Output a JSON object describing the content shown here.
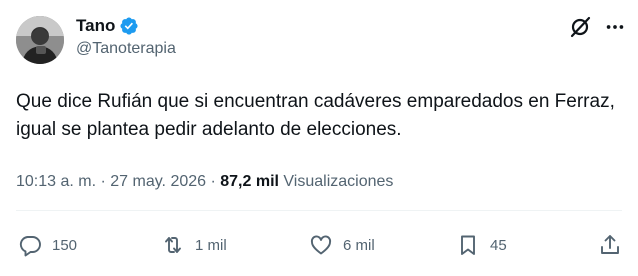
{
  "user": {
    "name": "Tano",
    "handle": "@Tanoterapia"
  },
  "tweet": {
    "text": "Que dice Rufián que si encuentran cadáveres emparedados en Ferraz, igual se plantea pedir adelanto de elecciones."
  },
  "meta": {
    "time": "10:13 a. m.",
    "separator": " · ",
    "date": "27 may. 2026",
    "views_separator": " · ",
    "views_count": "87,2 mil",
    "views_label": " Visualizaciones"
  },
  "actions": {
    "replies": "150",
    "retweets": "1 mil",
    "likes": "6 mil",
    "bookmarks": "45"
  },
  "icons": {
    "verified": "verified-badge-icon",
    "grok": "grok-icon",
    "more": "more-options-icon",
    "reply": "reply-icon",
    "retweet": "retweet-icon",
    "like": "heart-icon",
    "bookmark": "bookmark-icon",
    "share": "share-icon"
  },
  "colors": {
    "verified": "#1d9bf0",
    "text": "#0f1419",
    "secondary": "#536471"
  }
}
